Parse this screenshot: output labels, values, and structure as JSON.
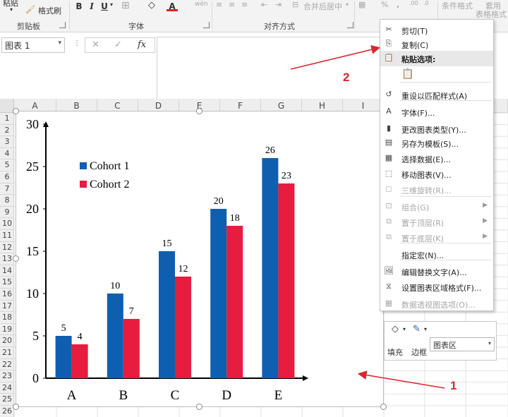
{
  "ribbon": {
    "paste_label": "粘贴",
    "format_painter_label": "格式刷",
    "bold_label": "B",
    "italic_label": "I",
    "underline_label": "U",
    "font_color_letter": "A",
    "merge_center_label": "合并后居中",
    "percent_label": "%",
    "comma_label": ",",
    "inc_decimal_label": ".00",
    "dec_decimal_label": ".0",
    "conditional_format_label": "条件格式",
    "table_format_label_1": "套用",
    "table_format_label_2": "表格格式",
    "groups": {
      "clipboard": "剪贴板",
      "font": "字体",
      "alignment": "对齐方式"
    }
  },
  "formula_bar": {
    "name_box": "图表 1",
    "fx_label": "fx",
    "formula_value": ""
  },
  "grid": {
    "columns": [
      "A",
      "B",
      "C",
      "D",
      "E",
      "F",
      "G",
      "H",
      "I"
    ],
    "rows": [
      "1",
      "2",
      "3",
      "4",
      "5",
      "6",
      "7",
      "8",
      "9",
      "10",
      "11",
      "12",
      "13",
      "14",
      "15",
      "16",
      "17",
      "18",
      "19",
      "20",
      "21",
      "22",
      "23",
      "24",
      "25",
      "26"
    ]
  },
  "chart_data": {
    "type": "bar",
    "categories": [
      "A",
      "B",
      "C",
      "D",
      "E"
    ],
    "series": [
      {
        "name": "Cohort 1",
        "values": [
          5,
          10,
          15,
          20,
          26
        ],
        "color": "#0f5fb0"
      },
      {
        "name": "Cohort 2",
        "values": [
          4,
          7,
          12,
          18,
          23
        ],
        "color": "#e71c3f"
      }
    ],
    "ylim": [
      0,
      30
    ],
    "yticks": [
      "0",
      "5",
      "10",
      "15",
      "20",
      "25",
      "30"
    ],
    "legend_position": "top-left",
    "data_labels": true,
    "grid": false
  },
  "context_menu": {
    "items": [
      {
        "label": "剪切(T)",
        "icon": "scissors-icon",
        "disabled": false
      },
      {
        "label": "复制(C)",
        "icon": "copy-icon",
        "disabled": false
      },
      {
        "label": "粘贴选项:",
        "icon": "paste-icon",
        "disabled": false,
        "header": true
      },
      {
        "label": "",
        "icon": "paste-option-icon",
        "disabled": false
      },
      {
        "label": "重设以匹配样式(A)",
        "icon": "reset-style-icon",
        "disabled": false
      },
      {
        "label": "字体(F)...",
        "icon": "font-icon",
        "disabled": false
      },
      {
        "label": "更改图表类型(Y)...",
        "icon": "chart-type-icon",
        "disabled": false
      },
      {
        "label": "另存为模板(S)...",
        "icon": "save-template-icon",
        "disabled": false
      },
      {
        "label": "选择数据(E)...",
        "icon": "select-data-icon",
        "disabled": false
      },
      {
        "label": "移动图表(V)...",
        "icon": "move-chart-icon",
        "disabled": false
      },
      {
        "label": "三维旋转(R)...",
        "icon": "3d-rotate-icon",
        "disabled": true
      },
      {
        "label": "组合(G)",
        "icon": "group-icon",
        "disabled": true,
        "submenu": true
      },
      {
        "label": "置于顶层(R)",
        "icon": "bring-front-icon",
        "disabled": true,
        "submenu": true
      },
      {
        "label": "置于底层(K)",
        "icon": "send-back-icon",
        "disabled": true,
        "submenu": true
      },
      {
        "label": "指定宏(N)...",
        "icon": "",
        "disabled": false
      },
      {
        "label": "编辑替换文字(A)...",
        "icon": "alt-text-icon",
        "disabled": false
      },
      {
        "label": "设置图表区域格式(F)...",
        "icon": "format-area-icon",
        "disabled": false
      },
      {
        "label": "数据透视图选项(O)...",
        "icon": "pivot-chart-icon",
        "disabled": true
      }
    ]
  },
  "mini_toolbar": {
    "fill_label": "填充",
    "border_label": "边框",
    "chart_element_value": "图表区"
  },
  "annotations": {
    "label_1": "1",
    "label_2": "2",
    "color": "#d9262c"
  }
}
